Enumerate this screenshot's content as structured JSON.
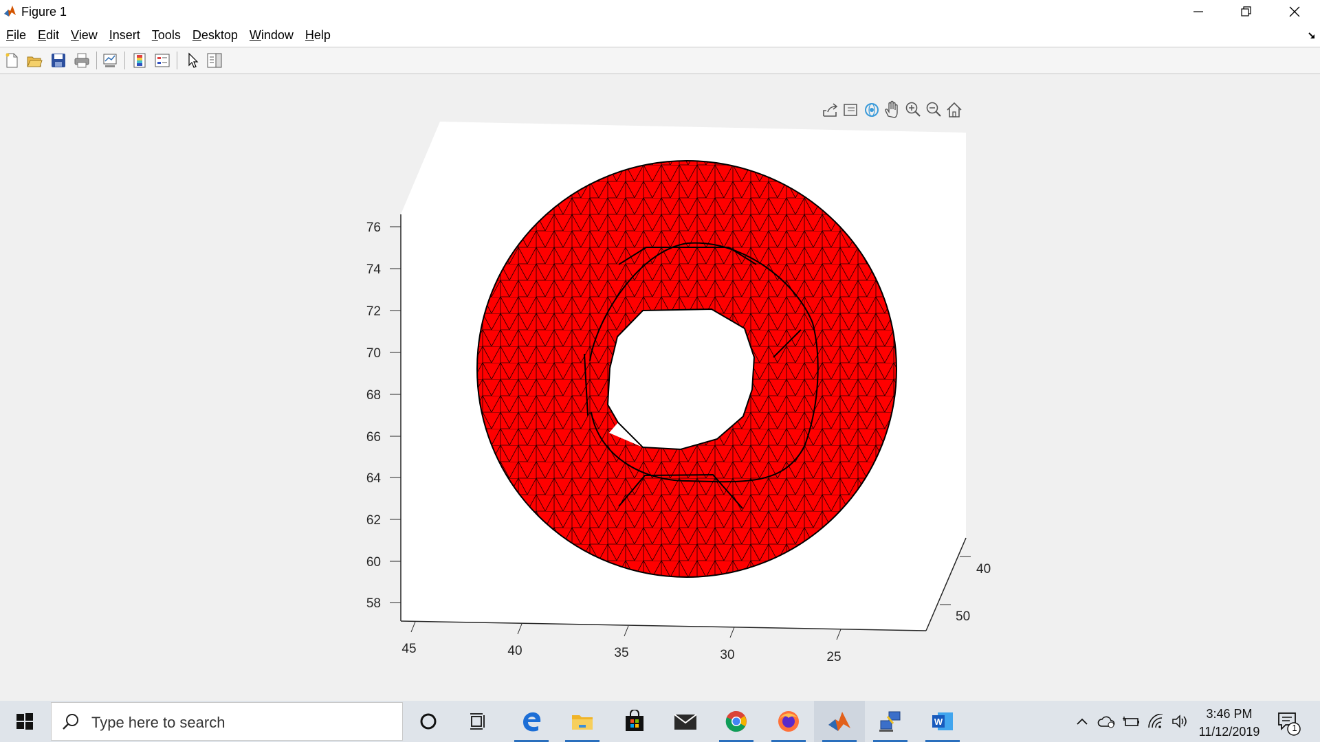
{
  "window": {
    "title": "Figure 1",
    "app_icon": "matlab-icon",
    "controls": [
      "minimize-icon",
      "restore-icon",
      "close-icon"
    ]
  },
  "menu": {
    "items": [
      {
        "label": "File",
        "mnemonic": "F",
        "rest": "ile"
      },
      {
        "label": "Edit",
        "mnemonic": "E",
        "rest": "dit"
      },
      {
        "label": "View",
        "mnemonic": "V",
        "rest": "iew"
      },
      {
        "label": "Insert",
        "mnemonic": "I",
        "rest": "nsert"
      },
      {
        "label": "Tools",
        "mnemonic": "T",
        "rest": "ools"
      },
      {
        "label": "Desktop",
        "mnemonic": "D",
        "rest": "esktop"
      },
      {
        "label": "Window",
        "mnemonic": "W",
        "rest": "indow"
      },
      {
        "label": "Help",
        "mnemonic": "H",
        "rest": "elp"
      }
    ],
    "dock_icon": "dock-arrow-icon"
  },
  "toolbar": {
    "buttons": [
      "new-figure-icon",
      "open-file-icon",
      "save-icon",
      "print-icon",
      "link-plot-icon",
      "insert-colorbar-icon",
      "insert-legend-icon",
      "edit-plot-icon",
      "property-inspector-icon"
    ]
  },
  "axes_toolbar": {
    "buttons": [
      "export-icon",
      "brush-icon",
      "rotate-3d-icon",
      "pan-icon",
      "zoom-in-icon",
      "zoom-out-icon",
      "home-icon"
    ]
  },
  "chart_data": {
    "type": "surface",
    "description_face_color": "#ff0000",
    "edge_color": "#000000",
    "z_ticks": [
      "76",
      "74",
      "72",
      "70",
      "68",
      "66",
      "64",
      "62",
      "60",
      "58"
    ],
    "x_ticks": [
      "45",
      "40",
      "35",
      "30",
      "25"
    ],
    "y_ticks": [
      "40",
      "50"
    ],
    "z_range": [
      57,
      77
    ],
    "x_range": [
      45,
      22
    ],
    "y_range": [
      38,
      52
    ],
    "grid": false
  },
  "taskbar": {
    "start_icon": "windows-start-icon",
    "search_placeholder": "Type here to search",
    "apps": [
      "cortana-icon",
      "task-view-icon",
      "edge-icon",
      "file-explorer-icon",
      "store-icon",
      "mail-icon",
      "chrome-icon",
      "firefox-icon",
      "matlab-icon",
      "network-app-icon",
      "word-icon"
    ],
    "tray": [
      "show-hidden-icons-icon",
      "onedrive-icon",
      "battery-icon",
      "wifi-icon",
      "volume-icon"
    ],
    "time": "3:46 PM",
    "date": "11/12/2019",
    "notification_count": "1"
  }
}
